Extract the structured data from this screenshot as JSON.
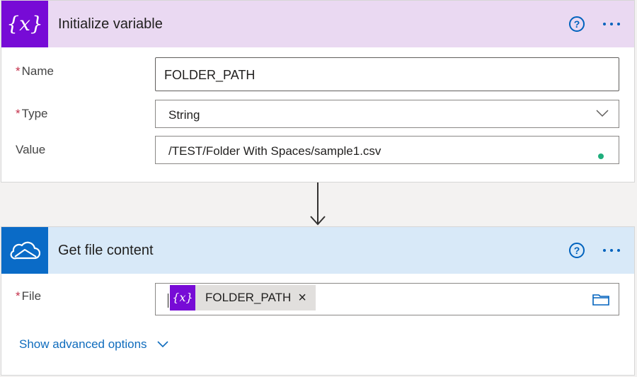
{
  "card1": {
    "title": "Initialize variable",
    "icon": "variable-icon",
    "name_label": "Name",
    "name_value": "FOLDER_PATH",
    "type_label": "Type",
    "type_value": "String",
    "value_label": "Value",
    "value_value": "/TEST/Folder With Spaces/sample1.csv",
    "required_mark": "*",
    "help_glyph": "?"
  },
  "card2": {
    "title": "Get file content",
    "icon": "onedrive-cloud-icon",
    "file_label": "File",
    "token_label": "FOLDER_PATH",
    "token_remove": "×",
    "required_mark": "*",
    "help_glyph": "?",
    "advanced_label": "Show advanced options"
  },
  "colors": {
    "variable_accent": "#770bd6",
    "onedrive_accent": "#0a6bc7",
    "link": "#0f6cbd",
    "status_dot": "#1fae7c"
  }
}
